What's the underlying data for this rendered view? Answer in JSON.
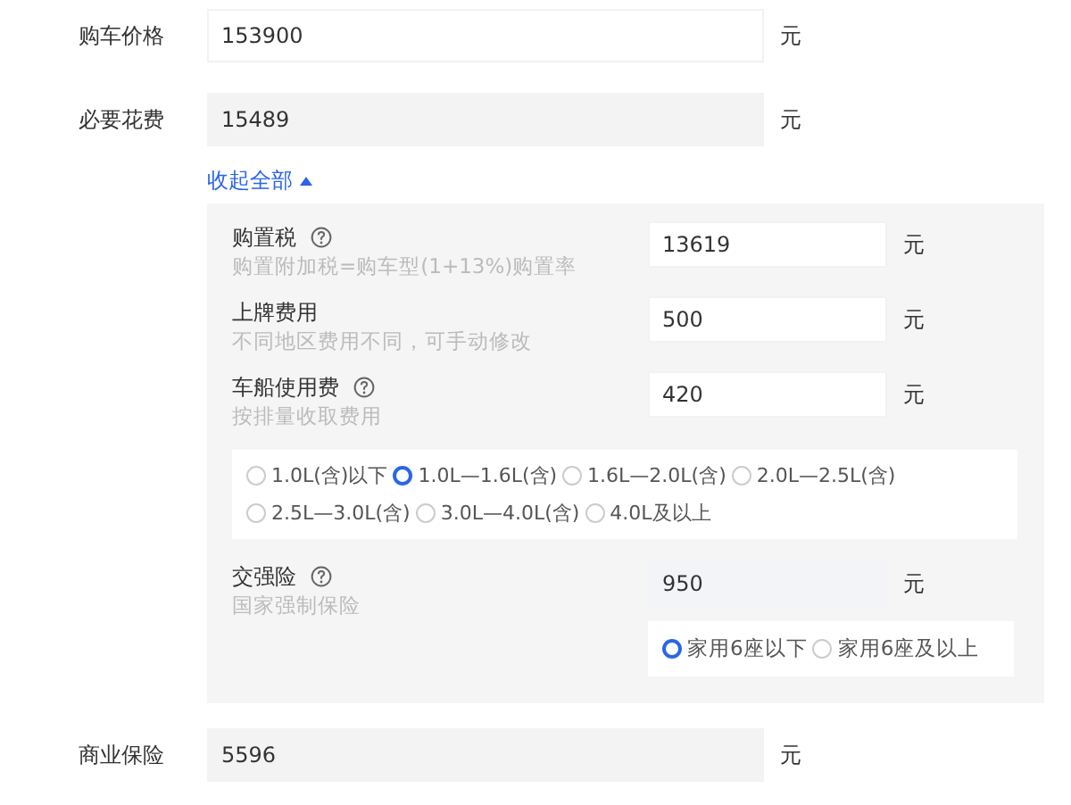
{
  "price": {
    "label": "购车价格",
    "value": "153900",
    "unit": "元",
    "editable": true
  },
  "required": {
    "label": "必要花费",
    "value": "15489",
    "unit": "元",
    "editable": false
  },
  "toggle": {
    "label": "收起全部",
    "expanded": true
  },
  "details": [
    {
      "label": "购置税",
      "help": true,
      "hint": "购置附加税=购车型(1+13%)购置率",
      "value": "13619",
      "unit": "元",
      "editable": true
    },
    {
      "label": "上牌费用",
      "help": false,
      "hint": "不同地区费用不同，可手动修改",
      "value": "500",
      "unit": "元",
      "editable": true
    },
    {
      "label": "车船使用费",
      "help": true,
      "hint": "按排量收取费用",
      "value": "420",
      "unit": "元",
      "editable": true,
      "options": [
        {
          "label": "1.0L(含)以下",
          "selected": false
        },
        {
          "label": "1.0L—1.6L(含)",
          "selected": true
        },
        {
          "label": "1.6L—2.0L(含)",
          "selected": false
        },
        {
          "label": "2.0L—2.5L(含)",
          "selected": false
        },
        {
          "label": "2.5L—3.0L(含)",
          "selected": false
        },
        {
          "label": "3.0L—4.0L(含)",
          "selected": false
        },
        {
          "label": "4.0L及以上",
          "selected": false
        }
      ]
    },
    {
      "label": "交强险",
      "help": true,
      "hint": "国家强制保险",
      "value": "950",
      "unit": "元",
      "editable": false,
      "options": [
        {
          "label": "家用6座以下",
          "selected": true
        },
        {
          "label": "家用6座及以上",
          "selected": false
        }
      ]
    }
  ],
  "insurance": {
    "label": "商业保险",
    "value": "5596",
    "unit": "元",
    "editable": false
  }
}
